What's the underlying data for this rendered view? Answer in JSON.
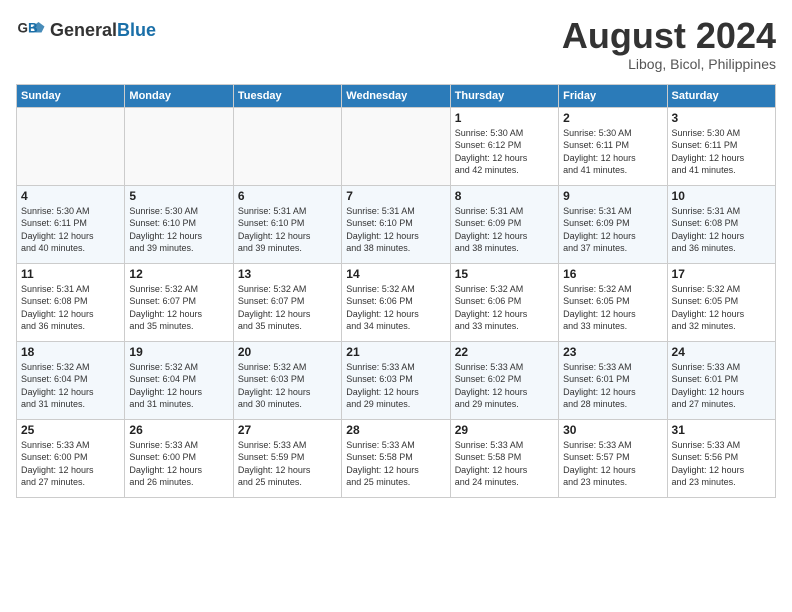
{
  "header": {
    "logo_line1": "General",
    "logo_line2": "Blue",
    "title": "August 2024",
    "subtitle": "Libog, Bicol, Philippines"
  },
  "days_of_week": [
    "Sunday",
    "Monday",
    "Tuesday",
    "Wednesday",
    "Thursday",
    "Friday",
    "Saturday"
  ],
  "weeks": [
    [
      {
        "num": "",
        "info": ""
      },
      {
        "num": "",
        "info": ""
      },
      {
        "num": "",
        "info": ""
      },
      {
        "num": "",
        "info": ""
      },
      {
        "num": "1",
        "info": "Sunrise: 5:30 AM\nSunset: 6:12 PM\nDaylight: 12 hours\nand 42 minutes."
      },
      {
        "num": "2",
        "info": "Sunrise: 5:30 AM\nSunset: 6:11 PM\nDaylight: 12 hours\nand 41 minutes."
      },
      {
        "num": "3",
        "info": "Sunrise: 5:30 AM\nSunset: 6:11 PM\nDaylight: 12 hours\nand 41 minutes."
      }
    ],
    [
      {
        "num": "4",
        "info": "Sunrise: 5:30 AM\nSunset: 6:11 PM\nDaylight: 12 hours\nand 40 minutes."
      },
      {
        "num": "5",
        "info": "Sunrise: 5:30 AM\nSunset: 6:10 PM\nDaylight: 12 hours\nand 39 minutes."
      },
      {
        "num": "6",
        "info": "Sunrise: 5:31 AM\nSunset: 6:10 PM\nDaylight: 12 hours\nand 39 minutes."
      },
      {
        "num": "7",
        "info": "Sunrise: 5:31 AM\nSunset: 6:10 PM\nDaylight: 12 hours\nand 38 minutes."
      },
      {
        "num": "8",
        "info": "Sunrise: 5:31 AM\nSunset: 6:09 PM\nDaylight: 12 hours\nand 38 minutes."
      },
      {
        "num": "9",
        "info": "Sunrise: 5:31 AM\nSunset: 6:09 PM\nDaylight: 12 hours\nand 37 minutes."
      },
      {
        "num": "10",
        "info": "Sunrise: 5:31 AM\nSunset: 6:08 PM\nDaylight: 12 hours\nand 36 minutes."
      }
    ],
    [
      {
        "num": "11",
        "info": "Sunrise: 5:31 AM\nSunset: 6:08 PM\nDaylight: 12 hours\nand 36 minutes."
      },
      {
        "num": "12",
        "info": "Sunrise: 5:32 AM\nSunset: 6:07 PM\nDaylight: 12 hours\nand 35 minutes."
      },
      {
        "num": "13",
        "info": "Sunrise: 5:32 AM\nSunset: 6:07 PM\nDaylight: 12 hours\nand 35 minutes."
      },
      {
        "num": "14",
        "info": "Sunrise: 5:32 AM\nSunset: 6:06 PM\nDaylight: 12 hours\nand 34 minutes."
      },
      {
        "num": "15",
        "info": "Sunrise: 5:32 AM\nSunset: 6:06 PM\nDaylight: 12 hours\nand 33 minutes."
      },
      {
        "num": "16",
        "info": "Sunrise: 5:32 AM\nSunset: 6:05 PM\nDaylight: 12 hours\nand 33 minutes."
      },
      {
        "num": "17",
        "info": "Sunrise: 5:32 AM\nSunset: 6:05 PM\nDaylight: 12 hours\nand 32 minutes."
      }
    ],
    [
      {
        "num": "18",
        "info": "Sunrise: 5:32 AM\nSunset: 6:04 PM\nDaylight: 12 hours\nand 31 minutes."
      },
      {
        "num": "19",
        "info": "Sunrise: 5:32 AM\nSunset: 6:04 PM\nDaylight: 12 hours\nand 31 minutes."
      },
      {
        "num": "20",
        "info": "Sunrise: 5:32 AM\nSunset: 6:03 PM\nDaylight: 12 hours\nand 30 minutes."
      },
      {
        "num": "21",
        "info": "Sunrise: 5:33 AM\nSunset: 6:03 PM\nDaylight: 12 hours\nand 29 minutes."
      },
      {
        "num": "22",
        "info": "Sunrise: 5:33 AM\nSunset: 6:02 PM\nDaylight: 12 hours\nand 29 minutes."
      },
      {
        "num": "23",
        "info": "Sunrise: 5:33 AM\nSunset: 6:01 PM\nDaylight: 12 hours\nand 28 minutes."
      },
      {
        "num": "24",
        "info": "Sunrise: 5:33 AM\nSunset: 6:01 PM\nDaylight: 12 hours\nand 27 minutes."
      }
    ],
    [
      {
        "num": "25",
        "info": "Sunrise: 5:33 AM\nSunset: 6:00 PM\nDaylight: 12 hours\nand 27 minutes."
      },
      {
        "num": "26",
        "info": "Sunrise: 5:33 AM\nSunset: 6:00 PM\nDaylight: 12 hours\nand 26 minutes."
      },
      {
        "num": "27",
        "info": "Sunrise: 5:33 AM\nSunset: 5:59 PM\nDaylight: 12 hours\nand 25 minutes."
      },
      {
        "num": "28",
        "info": "Sunrise: 5:33 AM\nSunset: 5:58 PM\nDaylight: 12 hours\nand 25 minutes."
      },
      {
        "num": "29",
        "info": "Sunrise: 5:33 AM\nSunset: 5:58 PM\nDaylight: 12 hours\nand 24 minutes."
      },
      {
        "num": "30",
        "info": "Sunrise: 5:33 AM\nSunset: 5:57 PM\nDaylight: 12 hours\nand 23 minutes."
      },
      {
        "num": "31",
        "info": "Sunrise: 5:33 AM\nSunset: 5:56 PM\nDaylight: 12 hours\nand 23 minutes."
      }
    ]
  ]
}
